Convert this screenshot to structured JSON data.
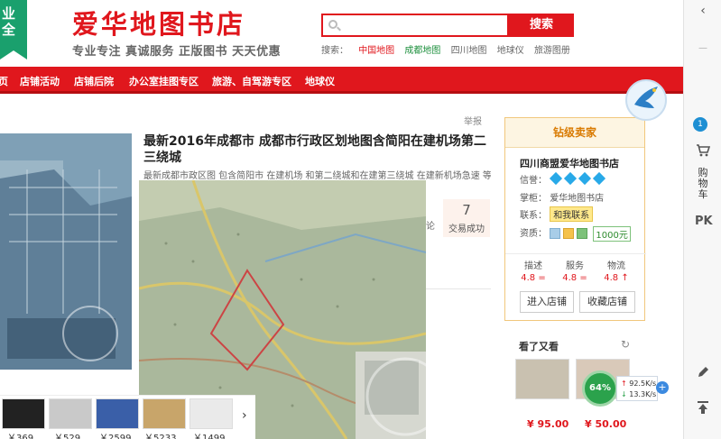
{
  "header": {
    "badge_text": "业全",
    "store_name": "爱华地图书店",
    "slogan": "专业专注 真诚服务 正版图书 天天优惠",
    "search_placeholder": "",
    "search_button": "搜索",
    "hot_label": "搜索：",
    "hot_words": [
      "中国地图",
      "成都地图",
      "四川地图",
      "地球仪",
      "旅游图册"
    ]
  },
  "nav": {
    "items": [
      "页",
      "店铺活动",
      "店铺后院",
      "办公室挂图专区",
      "旅游、自驾游专区",
      "地球仪"
    ]
  },
  "product": {
    "report": "举报",
    "title": "最新2016年成都市 成都市行政区划地图含简阳在建机场第二 三绕城",
    "desc": "最新成都市政区图 包含简阳市 在建机场 和第二绕城和在建第三绕城 在建新机场急速 等最",
    "deals_prev_label": "论",
    "deals_count": "7",
    "deals_label": "交易成功"
  },
  "thumbs": {
    "prices": [
      "￥369",
      "￥529",
      "￥2599",
      "￥5233",
      "￥1499"
    ],
    "arrow": "›"
  },
  "seller": {
    "badge": "钻级卖家",
    "name": "四川商盟爱华地图书店",
    "reputation_label": "信誉：",
    "owner_label": "掌柜：",
    "owner": "爱华地图书店",
    "contact_label": "联系：",
    "contact_tag": "和我联系",
    "qualification_label": "资质：",
    "deposit": "1000元",
    "scores": [
      {
        "label": "描述",
        "value": "4.8",
        "arrow": "="
      },
      {
        "label": "服务",
        "value": "4.8",
        "arrow": "="
      },
      {
        "label": "物流",
        "value": "4.8",
        "arrow": "↑"
      }
    ],
    "enter_button": "进入店铺",
    "favorite_button": "收藏店铺"
  },
  "recommend": {
    "title": "看了又看",
    "prices": [
      "¥ 95.00",
      "¥ 50.00"
    ]
  },
  "speed": {
    "percent": "64%",
    "up": "92.5K/s",
    "down": "13.3K/s"
  },
  "toolbar": {
    "cart_count": "1",
    "cart_label": "购物车",
    "pk_label": "PK"
  },
  "colors": {
    "brand_red": "#e0171d",
    "brand_green": "#1aa06d"
  }
}
